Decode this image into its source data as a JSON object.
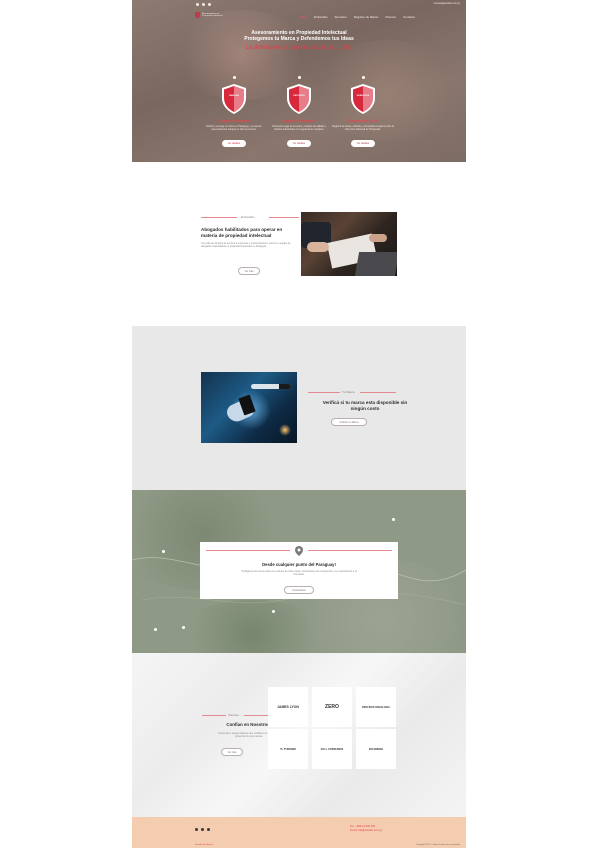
{
  "colors": {
    "accent": "#e63b48",
    "hero_bg": "#7f6d65",
    "footer_bg": "#f4ccb0",
    "section_gray": "#e8e8e8"
  },
  "topbar": {
    "social_icons": [
      "facebook-icon",
      "twitter-icon",
      "instagram-icon"
    ],
    "contact": "marcas@estudio.com.py"
  },
  "logo": {
    "text": "Asesoramiento en Propiedad Intelectual"
  },
  "nav": {
    "items": [
      "Inicio",
      "El Estudio",
      "Servicios",
      "Registro de Marca",
      "Clientes",
      "Contacto"
    ]
  },
  "hero": {
    "title_line1": "Asesoramiento en Propiedad Intelectual",
    "title_line2": "Protegemos tu Marca y Defendemos tus Ideas",
    "subtitle": "La defendemos para tu estudio a tu sitio",
    "columns": [
      {
        "shield_label": "MARCAS",
        "title": "Registro de Marcas",
        "text": "Verificá y protegé tu marca en Paraguay y el exterior. Asesoramiento integral en todo el proceso.",
        "button": "Ver detalles"
      },
      {
        "shield_label": "PATENTES",
        "title": "Registro de Patentes",
        "text": "Protección legal de inventos, modelos de utilidad y diseños industriales con seguimiento completo.",
        "button": "Ver detalles"
      },
      {
        "shield_label": "DERECHOS",
        "title": "Derechos de Autor",
        "text": "Registro de obras, software y contenidos creativos ante la Dirección Nacional de Propiedad.",
        "button": "Ver detalles"
      }
    ]
  },
  "estudio": {
    "label": "El Estudio",
    "title": "Abogados habilitados para operar en materia de propiedad intelectual",
    "text": "Con más de 20 años de servicio a empresas y emprendedores, somos un equipo de abogados especialistas en propiedad intelectual en Paraguay.",
    "button": "Ver más"
  },
  "marca": {
    "label": "Tu Marca",
    "title": "Verificá si tu marca esta disponible sin ningún costo",
    "button": "Verificar mi Marca"
  },
  "mapa": {
    "title": "Desde cualquier punto del Paraguay!",
    "text": "Trabajamos de forma online con clientes de todo el país. Consultanos sin compromiso y te respondemos a la brevedad.",
    "button": "Contactanos"
  },
  "clientes": {
    "label": "Clientes",
    "title": "Confían en Nosotros",
    "text": "Empresas y emprendedores que confiaron en nosotros la protección de sus marcas.",
    "button": "Ver más",
    "logos": [
      "JAMES LYON",
      "ZERO",
      "BIOS BIOS ONCOLOGIA",
      "TL TURISMO",
      "FULL CONSUMOS",
      "ESCONDIDA"
    ]
  },
  "footer": {
    "social_icons": [
      "facebook-icon",
      "twitter-icon",
      "instagram-icon"
    ],
    "phone": "Tel.: +595 21 000 000",
    "email": "Email: info@estudio.com.py",
    "brand": "Estudio de Marcas",
    "copyright": "Copyright 2021 © Todos los derechos reservados"
  }
}
